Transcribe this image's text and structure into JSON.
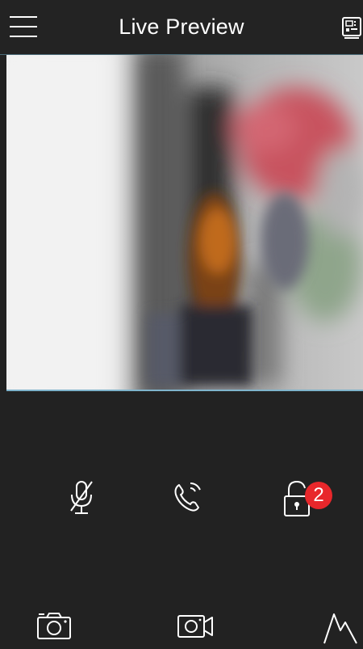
{
  "header": {
    "title": "Live Preview",
    "menu_icon": "hamburger-menu-icon",
    "device_icon": "device-panel-icon"
  },
  "preview": {
    "description_icon": "live-video-feed"
  },
  "controls": {
    "mute_icon": "microphone-muted-icon",
    "call_icon": "phone-call-icon",
    "unlock_icon": "unlock-padlock-icon",
    "unlock_badge_count": "2",
    "badge_color": "#e8272b"
  },
  "toolbar": {
    "snapshot_icon": "camera-snapshot-icon",
    "record_icon": "video-record-icon",
    "quality_icon": "image-quality-icon"
  },
  "colors": {
    "background": "#222222",
    "accent_line": "#7fb4cc",
    "icon": "#ffffff"
  }
}
